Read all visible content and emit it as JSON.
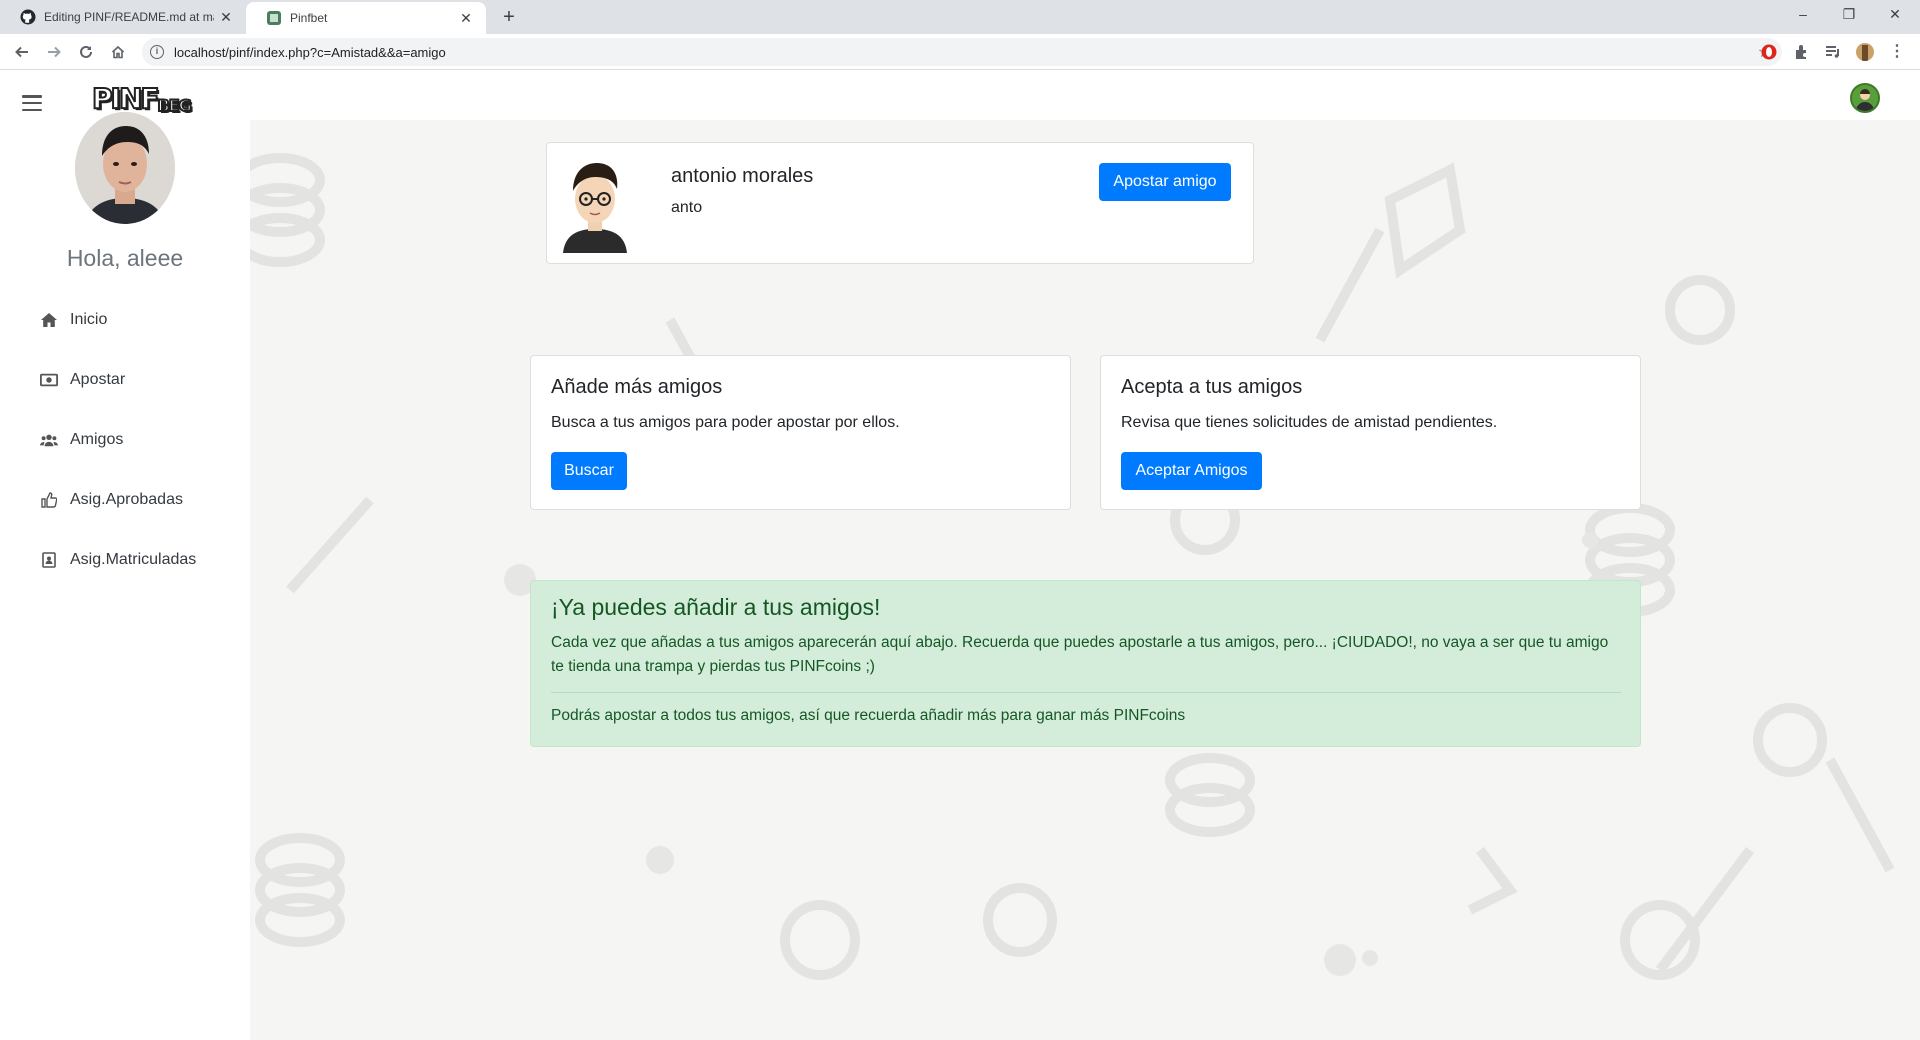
{
  "browser": {
    "tabs": [
      {
        "title": "Editing PINF/README.md at mas",
        "favicon": "github-icon"
      },
      {
        "title": "Pinfbet",
        "favicon": "pinfbet-icon"
      }
    ],
    "url": "localhost/pinf/index.php?c=Amistad&&a=amigo"
  },
  "app": {
    "logo": "PINF",
    "logo_sub": "BEG",
    "greeting": "Hola, aleee"
  },
  "sidebar": {
    "items": [
      {
        "label": "Inicio",
        "icon": "home-icon"
      },
      {
        "label": "Apostar",
        "icon": "money-bill-icon"
      },
      {
        "label": "Amigos",
        "icon": "users-icon"
      },
      {
        "label": "Asig.Aprobadas",
        "icon": "thumbs-up-icon"
      },
      {
        "label": "Asig.Matriculadas",
        "icon": "address-book-icon"
      }
    ]
  },
  "friend": {
    "name": "antonio morales",
    "username": "anto",
    "bet_button": "Apostar amigo"
  },
  "add_friends": {
    "title": "Añade más amigos",
    "text": "Busca a tus amigos para poder apostar por ellos.",
    "button": "Buscar"
  },
  "accept_friends": {
    "title": "Acepta a tus amigos",
    "text": "Revisa que tienes solicitudes de amistad pendientes.",
    "button": "Aceptar Amigos"
  },
  "alert": {
    "heading": "¡Ya puedes añadir a tus amigos!",
    "paragraph": "Cada vez que añadas a tus amigos aparecerán aquí abajo. Recuerda que puedes apostarle a tus amigos, pero... ¡CIUDADO!, no vaya a ser que tu amigo te tienda una trampa y pierdas tus PINFcoins ;)",
    "footer": "Podrás apostar a todos tus amigos, así que recuerda añadir más para ganar más PINFcoins"
  },
  "colors": {
    "primary": "#007bff",
    "alert_bg": "#d4edda",
    "alert_text": "#155724",
    "main_bg": "#f5f5f4"
  }
}
